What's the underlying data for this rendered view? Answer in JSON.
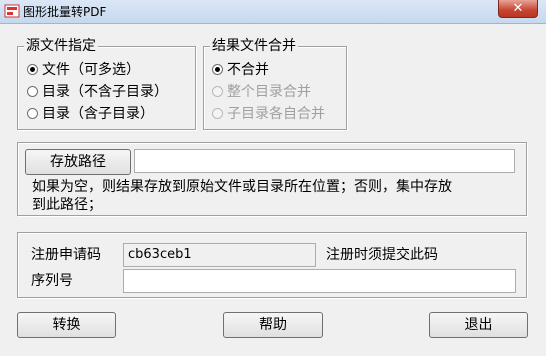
{
  "window": {
    "title": "图形批量转PDF",
    "close_label": "✕"
  },
  "source": {
    "legend": "源文件指定",
    "options": [
      {
        "label": "文件（可多选）",
        "checked": true
      },
      {
        "label": "目录（不含子目录）",
        "checked": false
      },
      {
        "label": "目录（含子目录）",
        "checked": false
      }
    ]
  },
  "merge": {
    "legend": "结果文件合并",
    "options": [
      {
        "label": "不合并",
        "checked": true,
        "enabled": true
      },
      {
        "label": "整个目录合并",
        "checked": false,
        "enabled": false
      },
      {
        "label": "子目录各自合并",
        "checked": false,
        "enabled": false
      }
    ]
  },
  "storage": {
    "button_label": "存放路径",
    "path_value": "",
    "hint_line1": "如果为空，则结果存放到原始文件或目录所在位置；否则，集中存放",
    "hint_line2": "到此路径；"
  },
  "registration": {
    "request_label": "注册申请码",
    "request_code": "cb63ceb1",
    "request_note": "注册时须提交此码",
    "serial_label": "序列号",
    "serial_value": ""
  },
  "actions": {
    "convert": "转换",
    "help": "帮助",
    "exit": "退出"
  }
}
